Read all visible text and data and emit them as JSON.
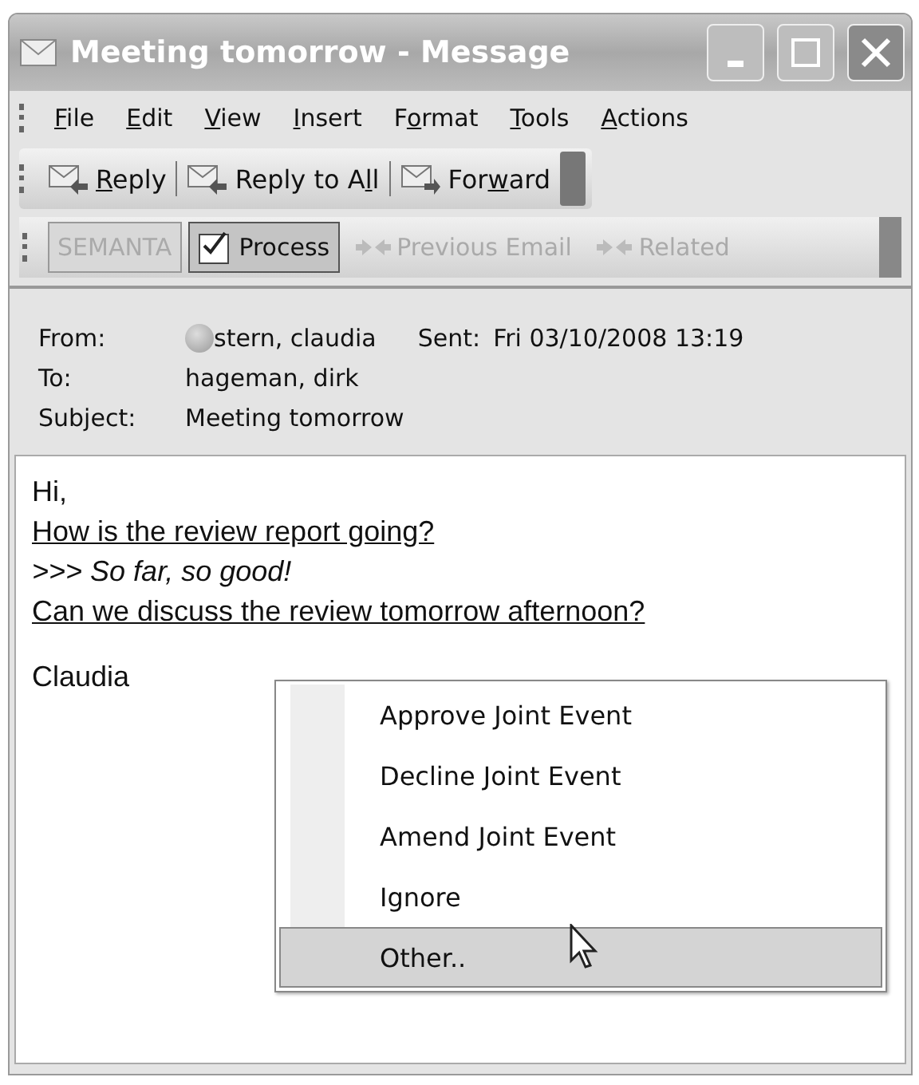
{
  "window": {
    "title": "Meeting tomorrow - Message"
  },
  "menu_bar": [
    {
      "key": "F",
      "post": "ile"
    },
    {
      "key": "E",
      "post": "dit"
    },
    {
      "key": "V",
      "post": "iew"
    },
    {
      "key": "I",
      "post": "nsert"
    },
    {
      "pre": "F",
      "key": "o",
      "post": "rmat"
    },
    {
      "key": "T",
      "post": "ools"
    },
    {
      "key": "A",
      "post": "ctions"
    }
  ],
  "toolbar": [
    {
      "key": "R",
      "post": "eply",
      "kind": "reply"
    },
    {
      "pre": "Reply to A",
      "key": "l",
      "post": "l",
      "kind": "reply-all"
    },
    {
      "pre": "For",
      "key": "w",
      "post": "ard",
      "kind": "forward"
    }
  ],
  "semanta_toolbar": [
    {
      "label": "SEMANTA",
      "kind": "text",
      "disabled": true,
      "pressed": false
    },
    {
      "label": "Process",
      "kind": "process",
      "disabled": false,
      "pressed": true
    },
    {
      "label": "Previous Email",
      "kind": "link",
      "disabled": true,
      "pressed": false
    },
    {
      "label": "Related",
      "kind": "link",
      "disabled": true,
      "pressed": false
    }
  ],
  "header": {
    "from_label": "From:",
    "from": "stern, claudia",
    "sent_label": "Sent:",
    "sent": "Fri 03/10/2008 13:19",
    "to_label": "To:",
    "to": "hageman, dirk",
    "subject_label": "Subject:",
    "subject": "Meeting tomorrow"
  },
  "body": [
    {
      "text": "Hi,",
      "kind": "plain"
    },
    {
      "text": "How is the review report going?",
      "kind": "underlined"
    },
    {
      "text": ">>> So far, so good!",
      "kind": "quote"
    },
    {
      "text": "Can we discuss the review tomorrow afternoon?",
      "kind": "underlined"
    },
    {
      "text": "Claudia",
      "kind": "signature"
    }
  ],
  "context_menu": [
    {
      "label": "Approve Joint Event",
      "selected": false
    },
    {
      "label": "Decline Joint Event",
      "selected": false
    },
    {
      "label": "Amend Joint Event",
      "selected": false
    },
    {
      "label": "Ignore",
      "selected": false
    },
    {
      "label": "Other..",
      "selected": true
    }
  ]
}
